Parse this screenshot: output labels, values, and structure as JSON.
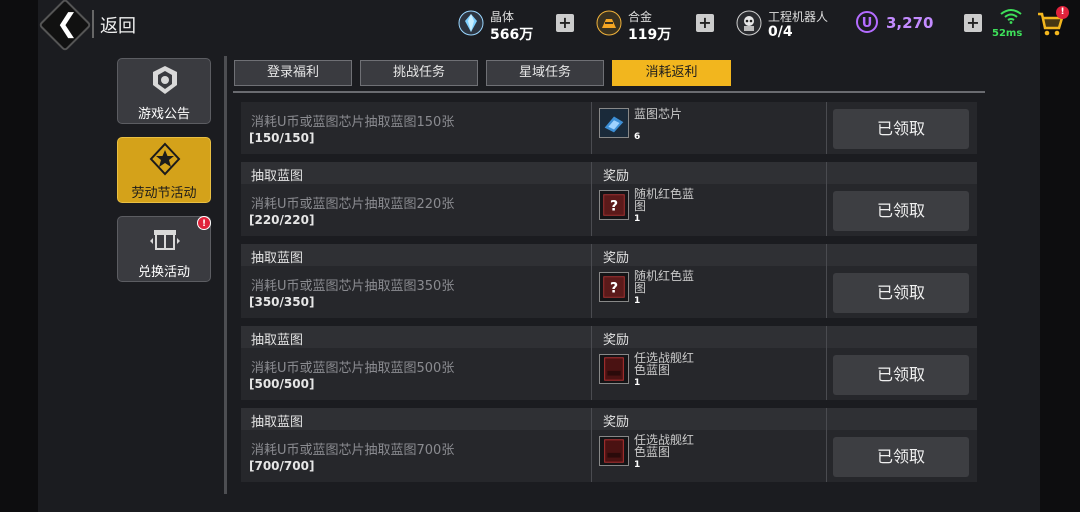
{
  "header": {
    "back_label": "返回",
    "resources": [
      {
        "name": "晶体",
        "value": "566万",
        "icon": "crystal-icon"
      },
      {
        "name": "合金",
        "value": "119万",
        "icon": "alloy-icon"
      },
      {
        "name": "工程机器人",
        "value": "0/4",
        "icon": "robot-icon"
      }
    ],
    "u_coin_symbol": "U",
    "u_coin_value": "3,270",
    "ping": "52ms",
    "cart_badge": "!"
  },
  "sidebar": {
    "items": [
      {
        "label": "游戏公告",
        "icon": "announcement-badge-icon",
        "active": false
      },
      {
        "label": "劳动节活动",
        "icon": "star-emblem-icon",
        "active": true
      },
      {
        "label": "兑换活动",
        "icon": "gift-box-icon",
        "active": false,
        "badge": "!"
      }
    ]
  },
  "tabs": [
    {
      "label": "登录福利",
      "active": false
    },
    {
      "label": "挑战任务",
      "active": false
    },
    {
      "label": "星域任务",
      "active": false
    },
    {
      "label": "消耗返利",
      "active": true
    }
  ],
  "rows": [
    {
      "title": "",
      "reward_header": "",
      "desc": "消耗U币或蓝图芯片抽取蓝图150张",
      "progress": "[150/150]",
      "reward_name": "蓝图芯片",
      "reward_qty": "6",
      "reward_icon": "blueprint-chip-icon",
      "button": "已领取"
    },
    {
      "title": "抽取蓝图",
      "reward_header": "奖励",
      "desc": "消耗U币或蓝图芯片抽取蓝图220张",
      "progress": "[220/220]",
      "reward_name": "随机红色蓝图",
      "reward_qty": "1",
      "reward_icon": "mystery-box-icon",
      "button": "已领取"
    },
    {
      "title": "抽取蓝图",
      "reward_header": "奖励",
      "desc": "消耗U币或蓝图芯片抽取蓝图350张",
      "progress": "[350/350]",
      "reward_name": "随机红色蓝图",
      "reward_qty": "1",
      "reward_icon": "mystery-box-icon",
      "button": "已领取"
    },
    {
      "title": "抽取蓝图",
      "reward_header": "奖励",
      "desc": "消耗U币或蓝图芯片抽取蓝图500张",
      "progress": "[500/500]",
      "reward_name": "任选战舰红色蓝图",
      "reward_qty": "1",
      "reward_icon": "red-blueprint-icon",
      "button": "已领取"
    },
    {
      "title": "抽取蓝图",
      "reward_header": "奖励",
      "desc": "消耗U币或蓝图芯片抽取蓝图700张",
      "progress": "[700/700]",
      "reward_name": "任选战舰红色蓝图",
      "reward_qty": "1",
      "reward_icon": "red-blueprint-icon",
      "button": "已领取"
    }
  ],
  "colors": {
    "accent": "#f2b61e",
    "badge": "#e0233c",
    "u_coin": "#b46cff",
    "ping": "#3ee05a"
  }
}
